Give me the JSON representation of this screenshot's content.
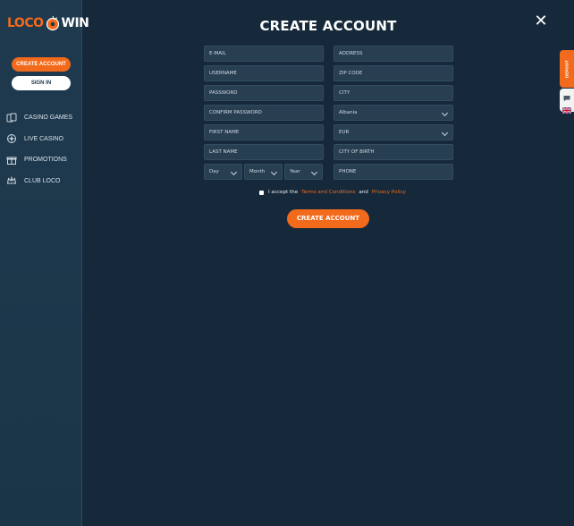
{
  "brand": {
    "logo_left": "LOCO",
    "logo_right": "WIN",
    "accent": "#f26a1b",
    "sidebar_bg": "#1f3a4f",
    "page_bg": "#16293a"
  },
  "sidebar": {
    "create_account": "CREATE ACCOUNT",
    "sign_in": "SIGN IN",
    "items": [
      {
        "label": "CASINO GAMES",
        "icon": "cards-icon"
      },
      {
        "label": "LIVE CASINO",
        "icon": "roulette-icon"
      },
      {
        "label": "PROMOTIONS",
        "icon": "gift-icon"
      },
      {
        "label": "CLUB LOCO",
        "icon": "crown-icon"
      }
    ]
  },
  "modal": {
    "title": "CREATE ACCOUNT",
    "close": "✕"
  },
  "form": {
    "left": {
      "email": "E-MAIL",
      "username": "USERNAME",
      "password": "PASSWORD",
      "confirm_password": "CONFIRM PASSWORD",
      "first_name": "FIRST NAME",
      "last_name": "LAST NAME",
      "day": "Day",
      "month": "Month",
      "year": "Year"
    },
    "right": {
      "address": "ADDRESS",
      "zip": "ZIP CODE",
      "city": "CITY",
      "country": "Albania",
      "currency": "EUR",
      "city_of_birth": "CITY OF BIRTH",
      "phone": "PHONE"
    }
  },
  "consent": {
    "prefix": "I accept the",
    "terms": "Terms and Conditions",
    "and": "and",
    "privacy": "Privacy Policy"
  },
  "submit_label": "CREATE ACCOUNT",
  "right_widgets": {
    "deposit_label": "DEPOSIT",
    "chat_icon": "chat-icon",
    "language_icon": "uk-flag-icon"
  }
}
